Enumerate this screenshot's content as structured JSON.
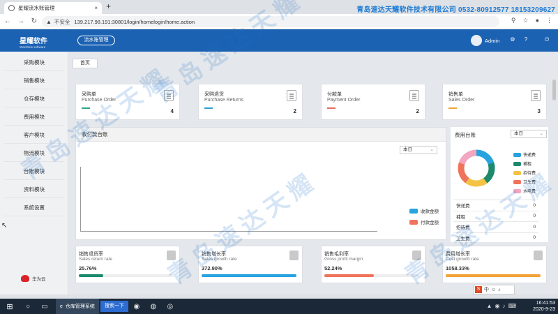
{
  "browser": {
    "tab_title": "星耀流水账管理",
    "tab_close": "×",
    "new_tab": "+",
    "security_label": "不安全",
    "url": "139.217.98.191:30801/login/homelogin!home.action",
    "watermark_text": "青岛速达天耀软件技术有限公司 0532-80912577 18153209627"
  },
  "header": {
    "logo_cn": "星耀软件",
    "logo_en": "Starshine software",
    "nav_pill": "流水账管理",
    "user": "Admin"
  },
  "sidebar": {
    "items": [
      {
        "label": "采购模块"
      },
      {
        "label": "销售模块"
      },
      {
        "label": "仓存模块"
      },
      {
        "label": "费用模块"
      },
      {
        "label": "客户模块"
      },
      {
        "label": "物流模块"
      },
      {
        "label": "台账模块"
      },
      {
        "label": "资料模块"
      },
      {
        "label": "系统设置"
      }
    ],
    "footer_label": "华为云"
  },
  "main": {
    "breadcrumb": "首页",
    "summary_cards": [
      {
        "title": "采购单",
        "subtitle": "Purchase Order",
        "value": "4",
        "color": "#2ba58a"
      },
      {
        "title": "采购退货",
        "subtitle": "Purchase Returns",
        "value": "2",
        "color": "#2b9fd3"
      },
      {
        "title": "付款单",
        "subtitle": "Payment Order",
        "value": "2",
        "color": "#e46b59"
      },
      {
        "title": "销售单",
        "subtitle": "Sales Order",
        "value": "3",
        "color": "#f2a33a"
      }
    ],
    "ledger": {
      "title": "收付款台账",
      "period": "本日",
      "legend": [
        {
          "label": "收款金额",
          "color": "#29a3de"
        },
        {
          "label": "付款金额",
          "color": "#f0735b"
        }
      ]
    },
    "fees": {
      "title": "费用台账",
      "period": "本日",
      "legend": [
        {
          "label": "快递费",
          "color": "#29a3de"
        },
        {
          "label": "補租",
          "color": "#1d8a6e"
        },
        {
          "label": "招待费",
          "color": "#f4c344"
        },
        {
          "label": "卫生费",
          "color": "#f0735b"
        },
        {
          "label": "水电费",
          "color": "#f2a6c0"
        }
      ],
      "rows": [
        {
          "name": "快递费",
          "value": "0"
        },
        {
          "name": "補租",
          "value": "0"
        },
        {
          "name": "招待费",
          "value": "0"
        },
        {
          "name": "卫生费",
          "value": "0"
        }
      ]
    },
    "rates": [
      {
        "title": "销售退货率",
        "subtitle": "Sales return rate",
        "value": "25.76%",
        "fill": 0.2576,
        "color": "#1d8a6e"
      },
      {
        "title": "销售增长率",
        "subtitle": "Sales growth rate",
        "value": "372.90%",
        "fill": 1.0,
        "color": "#29a3de"
      },
      {
        "title": "销售毛利率",
        "subtitle": "Gross profit margin",
        "value": "52.24%",
        "fill": 0.5224,
        "color": "#f0735b"
      },
      {
        "title": "费用增长率",
        "subtitle": "Cost growth rate",
        "value": "1058.33%",
        "fill": 1.0,
        "color": "#f2a33a"
      }
    ]
  },
  "watermark": "青岛速达天耀",
  "taskbar": {
    "app_label": "仓库管理系统",
    "search_label": "搜索一下",
    "time": "16:41:53",
    "date": "2020-9-23",
    "ime_label": "中"
  }
}
